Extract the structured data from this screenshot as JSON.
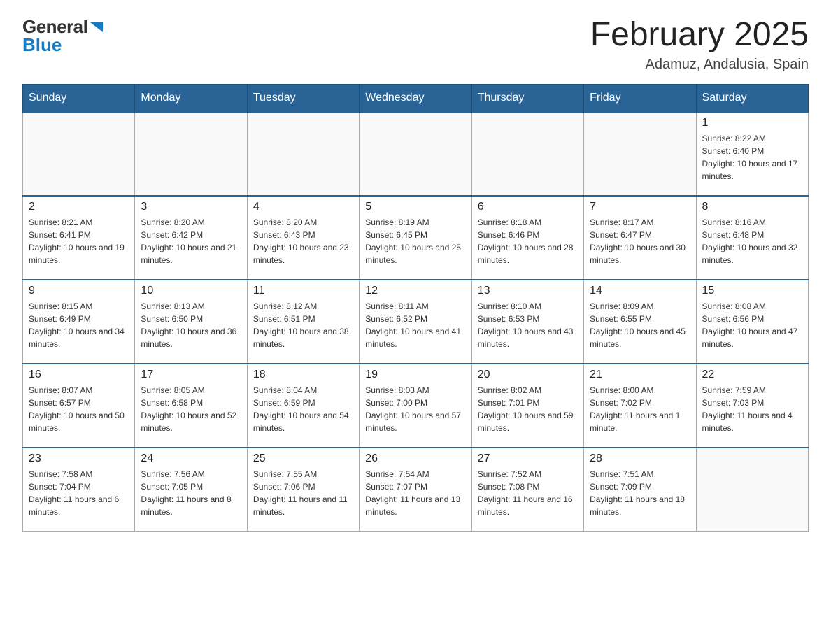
{
  "header": {
    "logo_text_general": "General",
    "logo_text_blue": "Blue",
    "title": "February 2025",
    "subtitle": "Adamuz, Andalusia, Spain"
  },
  "days_of_week": [
    "Sunday",
    "Monday",
    "Tuesday",
    "Wednesday",
    "Thursday",
    "Friday",
    "Saturday"
  ],
  "weeks": [
    [
      {
        "day": "",
        "info": ""
      },
      {
        "day": "",
        "info": ""
      },
      {
        "day": "",
        "info": ""
      },
      {
        "day": "",
        "info": ""
      },
      {
        "day": "",
        "info": ""
      },
      {
        "day": "",
        "info": ""
      },
      {
        "day": "1",
        "info": "Sunrise: 8:22 AM\nSunset: 6:40 PM\nDaylight: 10 hours and 17 minutes."
      }
    ],
    [
      {
        "day": "2",
        "info": "Sunrise: 8:21 AM\nSunset: 6:41 PM\nDaylight: 10 hours and 19 minutes."
      },
      {
        "day": "3",
        "info": "Sunrise: 8:20 AM\nSunset: 6:42 PM\nDaylight: 10 hours and 21 minutes."
      },
      {
        "day": "4",
        "info": "Sunrise: 8:20 AM\nSunset: 6:43 PM\nDaylight: 10 hours and 23 minutes."
      },
      {
        "day": "5",
        "info": "Sunrise: 8:19 AM\nSunset: 6:45 PM\nDaylight: 10 hours and 25 minutes."
      },
      {
        "day": "6",
        "info": "Sunrise: 8:18 AM\nSunset: 6:46 PM\nDaylight: 10 hours and 28 minutes."
      },
      {
        "day": "7",
        "info": "Sunrise: 8:17 AM\nSunset: 6:47 PM\nDaylight: 10 hours and 30 minutes."
      },
      {
        "day": "8",
        "info": "Sunrise: 8:16 AM\nSunset: 6:48 PM\nDaylight: 10 hours and 32 minutes."
      }
    ],
    [
      {
        "day": "9",
        "info": "Sunrise: 8:15 AM\nSunset: 6:49 PM\nDaylight: 10 hours and 34 minutes."
      },
      {
        "day": "10",
        "info": "Sunrise: 8:13 AM\nSunset: 6:50 PM\nDaylight: 10 hours and 36 minutes."
      },
      {
        "day": "11",
        "info": "Sunrise: 8:12 AM\nSunset: 6:51 PM\nDaylight: 10 hours and 38 minutes."
      },
      {
        "day": "12",
        "info": "Sunrise: 8:11 AM\nSunset: 6:52 PM\nDaylight: 10 hours and 41 minutes."
      },
      {
        "day": "13",
        "info": "Sunrise: 8:10 AM\nSunset: 6:53 PM\nDaylight: 10 hours and 43 minutes."
      },
      {
        "day": "14",
        "info": "Sunrise: 8:09 AM\nSunset: 6:55 PM\nDaylight: 10 hours and 45 minutes."
      },
      {
        "day": "15",
        "info": "Sunrise: 8:08 AM\nSunset: 6:56 PM\nDaylight: 10 hours and 47 minutes."
      }
    ],
    [
      {
        "day": "16",
        "info": "Sunrise: 8:07 AM\nSunset: 6:57 PM\nDaylight: 10 hours and 50 minutes."
      },
      {
        "day": "17",
        "info": "Sunrise: 8:05 AM\nSunset: 6:58 PM\nDaylight: 10 hours and 52 minutes."
      },
      {
        "day": "18",
        "info": "Sunrise: 8:04 AM\nSunset: 6:59 PM\nDaylight: 10 hours and 54 minutes."
      },
      {
        "day": "19",
        "info": "Sunrise: 8:03 AM\nSunset: 7:00 PM\nDaylight: 10 hours and 57 minutes."
      },
      {
        "day": "20",
        "info": "Sunrise: 8:02 AM\nSunset: 7:01 PM\nDaylight: 10 hours and 59 minutes."
      },
      {
        "day": "21",
        "info": "Sunrise: 8:00 AM\nSunset: 7:02 PM\nDaylight: 11 hours and 1 minute."
      },
      {
        "day": "22",
        "info": "Sunrise: 7:59 AM\nSunset: 7:03 PM\nDaylight: 11 hours and 4 minutes."
      }
    ],
    [
      {
        "day": "23",
        "info": "Sunrise: 7:58 AM\nSunset: 7:04 PM\nDaylight: 11 hours and 6 minutes."
      },
      {
        "day": "24",
        "info": "Sunrise: 7:56 AM\nSunset: 7:05 PM\nDaylight: 11 hours and 8 minutes."
      },
      {
        "day": "25",
        "info": "Sunrise: 7:55 AM\nSunset: 7:06 PM\nDaylight: 11 hours and 11 minutes."
      },
      {
        "day": "26",
        "info": "Sunrise: 7:54 AM\nSunset: 7:07 PM\nDaylight: 11 hours and 13 minutes."
      },
      {
        "day": "27",
        "info": "Sunrise: 7:52 AM\nSunset: 7:08 PM\nDaylight: 11 hours and 16 minutes."
      },
      {
        "day": "28",
        "info": "Sunrise: 7:51 AM\nSunset: 7:09 PM\nDaylight: 11 hours and 18 minutes."
      },
      {
        "day": "",
        "info": ""
      }
    ]
  ]
}
